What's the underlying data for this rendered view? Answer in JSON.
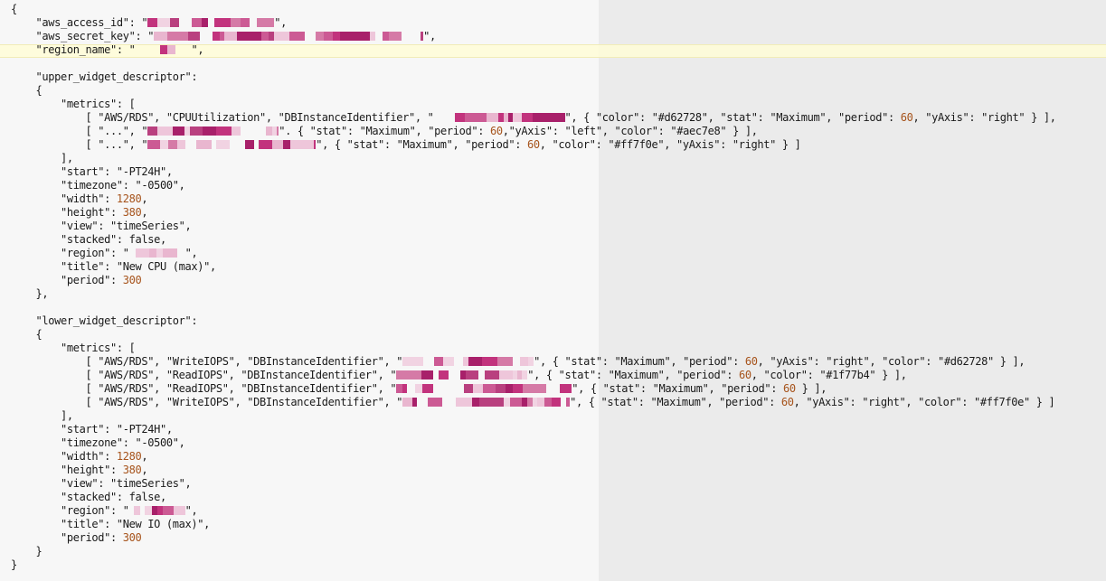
{
  "editor": {
    "accent": "#fffdd7"
  },
  "lines": [
    [
      {
        "t": "p",
        "v": "{"
      }
    ],
    [
      {
        "t": "p",
        "v": "    "
      },
      {
        "t": "k",
        "v": "\"aws_access_id\""
      },
      {
        "t": "p",
        "v": ": "
      },
      {
        "t": "s",
        "v": "\""
      },
      {
        "t": "r",
        "w": 140
      },
      {
        "t": "s",
        "v": "\""
      },
      {
        "t": "p",
        "v": ","
      }
    ],
    [
      {
        "t": "p",
        "v": "    "
      },
      {
        "t": "k",
        "v": "\"aws_secret_key\""
      },
      {
        "t": "p",
        "v": ": "
      },
      {
        "t": "s",
        "v": "\""
      },
      {
        "t": "r",
        "w": 298
      },
      {
        "t": "s",
        "v": "\""
      },
      {
        "t": "p",
        "v": ","
      }
    ],
    [
      {
        "t": "p",
        "v": "    "
      },
      {
        "t": "k",
        "v": "\"region_name\""
      },
      {
        "t": "p",
        "v": ": "
      },
      {
        "t": "s",
        "v": "\""
      },
      {
        "t": "r",
        "w": 62
      },
      {
        "t": "s",
        "v": "\""
      },
      {
        "t": "p",
        "v": ","
      }
    ],
    [],
    [
      {
        "t": "p",
        "v": "    "
      },
      {
        "t": "k",
        "v": "\"upper_widget_descriptor\""
      },
      {
        "t": "p",
        "v": ":"
      }
    ],
    [
      {
        "t": "p",
        "v": "    {"
      }
    ],
    [
      {
        "t": "p",
        "v": "        "
      },
      {
        "t": "k",
        "v": "\"metrics\""
      },
      {
        "t": "p",
        "v": ": ["
      }
    ],
    [
      {
        "t": "p",
        "v": "            [ "
      },
      {
        "t": "s",
        "v": "\"AWS/RDS\""
      },
      {
        "t": "p",
        "v": ", "
      },
      {
        "t": "s",
        "v": "\"CPUUtilization\""
      },
      {
        "t": "p",
        "v": ", "
      },
      {
        "t": "s",
        "v": "\"DBInstanceIdentifier\""
      },
      {
        "t": "p",
        "v": ", "
      },
      {
        "t": "s",
        "v": "\""
      },
      {
        "t": "r",
        "w": 145
      },
      {
        "t": "s",
        "v": "\""
      },
      {
        "t": "p",
        "v": ", { "
      },
      {
        "t": "k",
        "v": "\"color\""
      },
      {
        "t": "p",
        "v": ": "
      },
      {
        "t": "s",
        "v": "\"#d62728\""
      },
      {
        "t": "p",
        "v": ", "
      },
      {
        "t": "k",
        "v": "\"stat\""
      },
      {
        "t": "p",
        "v": ": "
      },
      {
        "t": "s",
        "v": "\"Maximum\""
      },
      {
        "t": "p",
        "v": ", "
      },
      {
        "t": "k",
        "v": "\"period\""
      },
      {
        "t": "p",
        "v": ": "
      },
      {
        "t": "n",
        "v": "60"
      },
      {
        "t": "p",
        "v": ", "
      },
      {
        "t": "k",
        "v": "\"yAxis\""
      },
      {
        "t": "p",
        "v": ": "
      },
      {
        "t": "s",
        "v": "\"right\""
      },
      {
        "t": "p",
        "v": " } ],"
      }
    ],
    [
      {
        "t": "p",
        "v": "            [ "
      },
      {
        "t": "s",
        "v": "\"...\""
      },
      {
        "t": "p",
        "v": ", "
      },
      {
        "t": "s",
        "v": "\""
      },
      {
        "t": "r",
        "w": 145
      },
      {
        "t": "s",
        "v": "\""
      },
      {
        "t": "p",
        "v": ". { "
      },
      {
        "t": "k",
        "v": "\"stat\""
      },
      {
        "t": "p",
        "v": ": "
      },
      {
        "t": "s",
        "v": "\"Maximum\""
      },
      {
        "t": "p",
        "v": ", "
      },
      {
        "t": "k",
        "v": "\"period\""
      },
      {
        "t": "p",
        "v": ": "
      },
      {
        "t": "n",
        "v": "60"
      },
      {
        "t": "p",
        "v": ","
      },
      {
        "t": "k",
        "v": "\"yAxis\""
      },
      {
        "t": "p",
        "v": ": "
      },
      {
        "t": "s",
        "v": "\"left\""
      },
      {
        "t": "p",
        "v": ", "
      },
      {
        "t": "k",
        "v": "\"color\""
      },
      {
        "t": "p",
        "v": ": "
      },
      {
        "t": "s",
        "v": "\"#aec7e8\""
      },
      {
        "t": "p",
        "v": " } ],"
      }
    ],
    [
      {
        "t": "p",
        "v": "            [ "
      },
      {
        "t": "s",
        "v": "\"...\""
      },
      {
        "t": "p",
        "v": ", "
      },
      {
        "t": "s",
        "v": "\""
      },
      {
        "t": "r",
        "w": 186
      },
      {
        "t": "s",
        "v": "\""
      },
      {
        "t": "p",
        "v": ", { "
      },
      {
        "t": "k",
        "v": "\"stat\""
      },
      {
        "t": "p",
        "v": ": "
      },
      {
        "t": "s",
        "v": "\"Maximum\""
      },
      {
        "t": "p",
        "v": ", "
      },
      {
        "t": "k",
        "v": "\"period\""
      },
      {
        "t": "p",
        "v": ": "
      },
      {
        "t": "n",
        "v": "60"
      },
      {
        "t": "p",
        "v": ", "
      },
      {
        "t": "k",
        "v": "\"color\""
      },
      {
        "t": "p",
        "v": ": "
      },
      {
        "t": "s",
        "v": "\"#ff7f0e\""
      },
      {
        "t": "p",
        "v": ", "
      },
      {
        "t": "k",
        "v": "\"yAxis\""
      },
      {
        "t": "p",
        "v": ": "
      },
      {
        "t": "s",
        "v": "\"right\""
      },
      {
        "t": "p",
        "v": " } ]"
      }
    ],
    [
      {
        "t": "p",
        "v": "        ],"
      }
    ],
    [
      {
        "t": "p",
        "v": "        "
      },
      {
        "t": "k",
        "v": "\"start\""
      },
      {
        "t": "p",
        "v": ": "
      },
      {
        "t": "s",
        "v": "\"-PT24H\""
      },
      {
        "t": "p",
        "v": ","
      }
    ],
    [
      {
        "t": "p",
        "v": "        "
      },
      {
        "t": "k",
        "v": "\"timezone\""
      },
      {
        "t": "p",
        "v": ": "
      },
      {
        "t": "s",
        "v": "\"-0500\""
      },
      {
        "t": "p",
        "v": ","
      }
    ],
    [
      {
        "t": "p",
        "v": "        "
      },
      {
        "t": "k",
        "v": "\"width\""
      },
      {
        "t": "p",
        "v": ": "
      },
      {
        "t": "n",
        "v": "1280"
      },
      {
        "t": "p",
        "v": ","
      }
    ],
    [
      {
        "t": "p",
        "v": "        "
      },
      {
        "t": "k",
        "v": "\"height\""
      },
      {
        "t": "p",
        "v": ": "
      },
      {
        "t": "n",
        "v": "380"
      },
      {
        "t": "p",
        "v": ","
      }
    ],
    [
      {
        "t": "p",
        "v": "        "
      },
      {
        "t": "k",
        "v": "\"view\""
      },
      {
        "t": "p",
        "v": ": "
      },
      {
        "t": "s",
        "v": "\"timeSeries\""
      },
      {
        "t": "p",
        "v": ","
      }
    ],
    [
      {
        "t": "p",
        "v": "        "
      },
      {
        "t": "k",
        "v": "\"stacked\""
      },
      {
        "t": "p",
        "v": ": false,"
      }
    ],
    [
      {
        "t": "p",
        "v": "        "
      },
      {
        "t": "k",
        "v": "\"region\""
      },
      {
        "t": "p",
        "v": ": "
      },
      {
        "t": "s",
        "v": "\""
      },
      {
        "t": "r",
        "w": 62
      },
      {
        "t": "s",
        "v": "\""
      },
      {
        "t": "p",
        "v": ","
      }
    ],
    [
      {
        "t": "p",
        "v": "        "
      },
      {
        "t": "k",
        "v": "\"title\""
      },
      {
        "t": "p",
        "v": ": "
      },
      {
        "t": "s",
        "v": "\"New CPU (max)\""
      },
      {
        "t": "p",
        "v": ","
      }
    ],
    [
      {
        "t": "p",
        "v": "        "
      },
      {
        "t": "k",
        "v": "\"period\""
      },
      {
        "t": "p",
        "v": ": "
      },
      {
        "t": "n",
        "v": "300"
      }
    ],
    [
      {
        "t": "p",
        "v": "    },"
      }
    ],
    [],
    [
      {
        "t": "p",
        "v": "    "
      },
      {
        "t": "k",
        "v": "\"lower_widget_descriptor\""
      },
      {
        "t": "p",
        "v": ":"
      }
    ],
    [
      {
        "t": "p",
        "v": "    {"
      }
    ],
    [
      {
        "t": "p",
        "v": "        "
      },
      {
        "t": "k",
        "v": "\"metrics\""
      },
      {
        "t": "p",
        "v": ": ["
      }
    ],
    [
      {
        "t": "p",
        "v": "            [ "
      },
      {
        "t": "s",
        "v": "\"AWS/RDS\""
      },
      {
        "t": "p",
        "v": ", "
      },
      {
        "t": "s",
        "v": "\"WriteIOPS\""
      },
      {
        "t": "p",
        "v": ", "
      },
      {
        "t": "s",
        "v": "\"DBInstanceIdentifier\""
      },
      {
        "t": "p",
        "v": ", "
      },
      {
        "t": "s",
        "v": "\""
      },
      {
        "t": "r",
        "w": 145
      },
      {
        "t": "s",
        "v": "\""
      },
      {
        "t": "p",
        "v": ", { "
      },
      {
        "t": "k",
        "v": "\"stat\""
      },
      {
        "t": "p",
        "v": ": "
      },
      {
        "t": "s",
        "v": "\"Maximum\""
      },
      {
        "t": "p",
        "v": ", "
      },
      {
        "t": "k",
        "v": "\"period\""
      },
      {
        "t": "p",
        "v": ": "
      },
      {
        "t": "n",
        "v": "60"
      },
      {
        "t": "p",
        "v": ", "
      },
      {
        "t": "k",
        "v": "\"yAxis\""
      },
      {
        "t": "p",
        "v": ": "
      },
      {
        "t": "s",
        "v": "\"right\""
      },
      {
        "t": "p",
        "v": ", "
      },
      {
        "t": "k",
        "v": "\"color\""
      },
      {
        "t": "p",
        "v": ": "
      },
      {
        "t": "s",
        "v": "\"#d62728\""
      },
      {
        "t": "p",
        "v": " } ],"
      }
    ],
    [
      {
        "t": "p",
        "v": "            [ "
      },
      {
        "t": "s",
        "v": "\"AWS/RDS\""
      },
      {
        "t": "p",
        "v": ", "
      },
      {
        "t": "s",
        "v": "\"ReadIOPS\""
      },
      {
        "t": "p",
        "v": ", "
      },
      {
        "t": "s",
        "v": "\"DBInstanceIdentifier\""
      },
      {
        "t": "p",
        "v": ", "
      },
      {
        "t": "s",
        "v": "\""
      },
      {
        "t": "r",
        "w": 145
      },
      {
        "t": "s",
        "v": "\""
      },
      {
        "t": "p",
        "v": ", { "
      },
      {
        "t": "k",
        "v": "\"stat\""
      },
      {
        "t": "p",
        "v": ": "
      },
      {
        "t": "s",
        "v": "\"Maximum\""
      },
      {
        "t": "p",
        "v": ", "
      },
      {
        "t": "k",
        "v": "\"period\""
      },
      {
        "t": "p",
        "v": ": "
      },
      {
        "t": "n",
        "v": "60"
      },
      {
        "t": "p",
        "v": ", "
      },
      {
        "t": "k",
        "v": "\"color\""
      },
      {
        "t": "p",
        "v": ": "
      },
      {
        "t": "s",
        "v": "\"#1f77b4\""
      },
      {
        "t": "p",
        "v": " } ],"
      }
    ],
    [
      {
        "t": "p",
        "v": "            [ "
      },
      {
        "t": "s",
        "v": "\"AWS/RDS\""
      },
      {
        "t": "p",
        "v": ", "
      },
      {
        "t": "s",
        "v": "\"ReadIOPS\""
      },
      {
        "t": "p",
        "v": ", "
      },
      {
        "t": "s",
        "v": "\"DBInstanceIdentifier\""
      },
      {
        "t": "p",
        "v": ", "
      },
      {
        "t": "s",
        "v": "\""
      },
      {
        "t": "r",
        "w": 194
      },
      {
        "t": "s",
        "v": "\""
      },
      {
        "t": "p",
        "v": ", { "
      },
      {
        "t": "k",
        "v": "\"stat\""
      },
      {
        "t": "p",
        "v": ": "
      },
      {
        "t": "s",
        "v": "\"Maximum\""
      },
      {
        "t": "p",
        "v": ", "
      },
      {
        "t": "k",
        "v": "\"period\""
      },
      {
        "t": "p",
        "v": ": "
      },
      {
        "t": "n",
        "v": "60"
      },
      {
        "t": "p",
        "v": " } ],"
      }
    ],
    [
      {
        "t": "p",
        "v": "            [ "
      },
      {
        "t": "s",
        "v": "\"AWS/RDS\""
      },
      {
        "t": "p",
        "v": ", "
      },
      {
        "t": "s",
        "v": "\"WriteIOPS\""
      },
      {
        "t": "p",
        "v": ", "
      },
      {
        "t": "s",
        "v": "\"DBInstanceIdentifier\""
      },
      {
        "t": "p",
        "v": ", "
      },
      {
        "t": "s",
        "v": "\""
      },
      {
        "t": "r",
        "w": 185
      },
      {
        "t": "s",
        "v": "\""
      },
      {
        "t": "p",
        "v": ", { "
      },
      {
        "t": "k",
        "v": "\"stat\""
      },
      {
        "t": "p",
        "v": ": "
      },
      {
        "t": "s",
        "v": "\"Maximum\""
      },
      {
        "t": "p",
        "v": ", "
      },
      {
        "t": "k",
        "v": "\"period\""
      },
      {
        "t": "p",
        "v": ": "
      },
      {
        "t": "n",
        "v": "60"
      },
      {
        "t": "p",
        "v": ", "
      },
      {
        "t": "k",
        "v": "\"yAxis\""
      },
      {
        "t": "p",
        "v": ": "
      },
      {
        "t": "s",
        "v": "\"right\""
      },
      {
        "t": "p",
        "v": ", "
      },
      {
        "t": "k",
        "v": "\"color\""
      },
      {
        "t": "p",
        "v": ": "
      },
      {
        "t": "s",
        "v": "\"#ff7f0e\""
      },
      {
        "t": "p",
        "v": " } ]"
      }
    ],
    [
      {
        "t": "p",
        "v": "        ],"
      }
    ],
    [
      {
        "t": "p",
        "v": "        "
      },
      {
        "t": "k",
        "v": "\"start\""
      },
      {
        "t": "p",
        "v": ": "
      },
      {
        "t": "s",
        "v": "\"-PT24H\""
      },
      {
        "t": "p",
        "v": ","
      }
    ],
    [
      {
        "t": "p",
        "v": "        "
      },
      {
        "t": "k",
        "v": "\"timezone\""
      },
      {
        "t": "p",
        "v": ": "
      },
      {
        "t": "s",
        "v": "\"-0500\""
      },
      {
        "t": "p",
        "v": ","
      }
    ],
    [
      {
        "t": "p",
        "v": "        "
      },
      {
        "t": "k",
        "v": "\"width\""
      },
      {
        "t": "p",
        "v": ": "
      },
      {
        "t": "n",
        "v": "1280"
      },
      {
        "t": "p",
        "v": ","
      }
    ],
    [
      {
        "t": "p",
        "v": "        "
      },
      {
        "t": "k",
        "v": "\"height\""
      },
      {
        "t": "p",
        "v": ": "
      },
      {
        "t": "n",
        "v": "380"
      },
      {
        "t": "p",
        "v": ","
      }
    ],
    [
      {
        "t": "p",
        "v": "        "
      },
      {
        "t": "k",
        "v": "\"view\""
      },
      {
        "t": "p",
        "v": ": "
      },
      {
        "t": "s",
        "v": "\"timeSeries\""
      },
      {
        "t": "p",
        "v": ","
      }
    ],
    [
      {
        "t": "p",
        "v": "        "
      },
      {
        "t": "k",
        "v": "\"stacked\""
      },
      {
        "t": "p",
        "v": ": false,"
      }
    ],
    [
      {
        "t": "p",
        "v": "        "
      },
      {
        "t": "k",
        "v": "\"region\""
      },
      {
        "t": "p",
        "v": ": "
      },
      {
        "t": "s",
        "v": "\""
      },
      {
        "t": "r",
        "w": 62
      },
      {
        "t": "s",
        "v": "\""
      },
      {
        "t": "p",
        "v": ","
      }
    ],
    [
      {
        "t": "p",
        "v": "        "
      },
      {
        "t": "k",
        "v": "\"title\""
      },
      {
        "t": "p",
        "v": ": "
      },
      {
        "t": "s",
        "v": "\"New IO (max)\""
      },
      {
        "t": "p",
        "v": ","
      }
    ],
    [
      {
        "t": "p",
        "v": "        "
      },
      {
        "t": "k",
        "v": "\"period\""
      },
      {
        "t": "p",
        "v": ": "
      },
      {
        "t": "n",
        "v": "300"
      }
    ],
    [
      {
        "t": "p",
        "v": "    }"
      }
    ],
    [
      {
        "t": "p",
        "v": "}"
      }
    ]
  ]
}
